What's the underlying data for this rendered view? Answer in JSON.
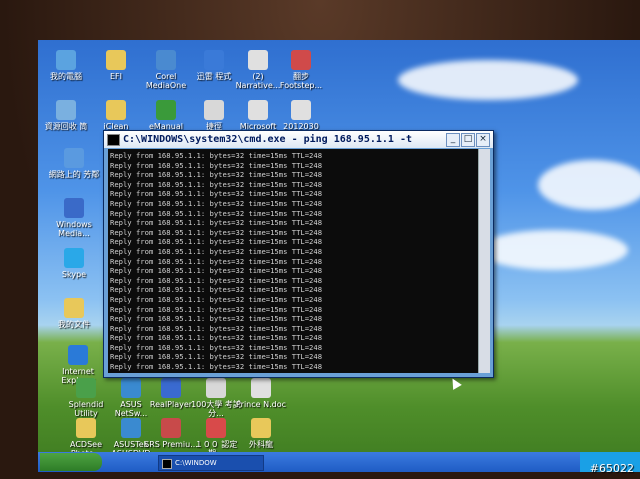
{
  "window": {
    "title": "C:\\WINDOWS\\system32\\cmd.exe - ping 168.95.1.1 -t",
    "minimize": "_",
    "maximize": "□",
    "close": "×"
  },
  "console_lines": [
    "Reply from 168.95.1.1: bytes=32 time=15ms TTL=248",
    "Reply from 168.95.1.1: bytes=32 time=15ms TTL=248",
    "Reply from 168.95.1.1: bytes=32 time=15ms TTL=248",
    "Reply from 168.95.1.1: bytes=32 time=15ms TTL=248",
    "Reply from 168.95.1.1: bytes=32 time=15ms TTL=248",
    "Reply from 168.95.1.1: bytes=32 time=15ms TTL=248",
    "Reply from 168.95.1.1: bytes=32 time=15ms TTL=248",
    "Reply from 168.95.1.1: bytes=32 time=15ms TTL=248",
    "Reply from 168.95.1.1: bytes=32 time=15ms TTL=248",
    "Reply from 168.95.1.1: bytes=32 time=15ms TTL=248",
    "Reply from 168.95.1.1: bytes=32 time=15ms TTL=248",
    "Reply from 168.95.1.1: bytes=32 time=15ms TTL=248",
    "Reply from 168.95.1.1: bytes=32 time=15ms TTL=248",
    "Reply from 168.95.1.1: bytes=32 time=15ms TTL=248",
    "Reply from 168.95.1.1: bytes=32 time=15ms TTL=248",
    "Reply from 168.95.1.1: bytes=32 time=15ms TTL=248",
    "Reply from 168.95.1.1: bytes=32 time=15ms TTL=248",
    "Reply from 168.95.1.1: bytes=32 time=15ms TTL=248",
    "Reply from 168.95.1.1: bytes=32 time=15ms TTL=248",
    "Reply from 168.95.1.1: bytes=32 time=15ms TTL=248",
    "Reply from 168.95.1.1: bytes=32 time=15ms TTL=248",
    "Reply from 168.95.1.1: bytes=32 time=15ms TTL=248",
    "Reply from 168.95.1.1: bytes=32 time=15ms TTL=248",
    "Reply from 168.95.1.1: bytes=32 time=15ms TTL=248"
  ],
  "desktop_icons": [
    {
      "label": "我的電腦",
      "color": "#5ba3e0"
    },
    {
      "label": "EFI",
      "color": "#e8c85a"
    },
    {
      "label": "Corel MediaOne",
      "color": "#4a8ad0"
    },
    {
      "label": "迅雷 程式",
      "color": "#3a7ad8"
    },
    {
      "label": "(2) Narrative...",
      "color": "#e0e0e0"
    },
    {
      "label": "翻步 Footstep...",
      "color": "#d04a4a"
    },
    {
      "label": "資源回收 筒",
      "color": "#7ab0e0"
    },
    {
      "label": "iClean",
      "color": "#e8c85a"
    },
    {
      "label": "eManual",
      "color": "#3a9a3a"
    },
    {
      "label": "捷徑",
      "color": "#d8d8d8"
    },
    {
      "label": "Microsoft",
      "color": "#e0e0e0"
    },
    {
      "label": "2012030",
      "color": "#e0e0e0"
    },
    {
      "label": "網路上的 芳鄰",
      "color": "#5a9ae0"
    },
    {
      "label": "Windows Media...",
      "color": "#3a6ac8"
    },
    {
      "label": "Skype",
      "color": "#2aa8e8"
    },
    {
      "label": "我的文件",
      "color": "#e8c85a"
    },
    {
      "label": "Internet Explorer",
      "color": "#2a7ad8"
    },
    {
      "label": "Splendid Utility",
      "color": "#4aa04a"
    },
    {
      "label": "ASUS NetSw...",
      "color": "#3a8ad0"
    },
    {
      "label": "RealPlayer",
      "color": "#3a6ad0"
    },
    {
      "label": "100大學 考試分...",
      "color": "#d8d8d8"
    },
    {
      "label": "Prince N.doc",
      "color": "#e0e0e0"
    },
    {
      "label": "ACDSee Photo...",
      "color": "#e8c85a"
    },
    {
      "label": "ASUSTek ASUSDVD",
      "color": "#3a8ad0"
    },
    {
      "label": "SRS Premiu...",
      "color": "#c84a4a"
    },
    {
      "label": "１００ 認定期...",
      "color": "#d84a4a"
    },
    {
      "label": "外科龍",
      "color": "#e8c85a"
    }
  ],
  "taskbar": {
    "task_label": "C:\\WINDOW"
  },
  "watermark": "#65022"
}
